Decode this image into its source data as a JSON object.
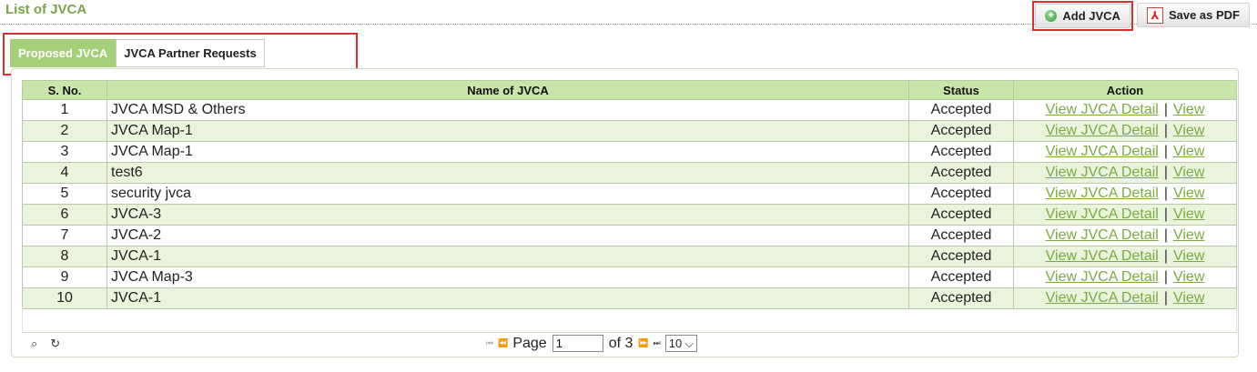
{
  "page": {
    "title": "List of JVCA"
  },
  "toolbar": {
    "add_label": "Add JVCA",
    "add_icon": "plus-circle-icon",
    "pdf_label": "Save as PDF",
    "pdf_icon": "pdf-icon"
  },
  "tabs": [
    {
      "label": "Proposed JVCA",
      "active": true
    },
    {
      "label": "JVCA Partner Requests",
      "active": false
    }
  ],
  "table": {
    "headers": [
      "S. No.",
      "Name of JVCA",
      "Status",
      "Action"
    ],
    "action_detail": "View JVCA Detail",
    "action_sep": "|",
    "action_view": "View",
    "rows": [
      {
        "sno": "1",
        "name": "JVCA MSD & Others",
        "status": "Accepted"
      },
      {
        "sno": "2",
        "name": "JVCA Map-1",
        "status": "Accepted"
      },
      {
        "sno": "3",
        "name": "JVCA Map-1",
        "status": "Accepted"
      },
      {
        "sno": "4",
        "name": "test6",
        "status": "Accepted"
      },
      {
        "sno": "5",
        "name": "security jvca",
        "status": "Accepted"
      },
      {
        "sno": "6",
        "name": "JVCA-3",
        "status": "Accepted"
      },
      {
        "sno": "7",
        "name": "JVCA-2",
        "status": "Accepted"
      },
      {
        "sno": "8",
        "name": "JVCA-1",
        "status": "Accepted"
      },
      {
        "sno": "9",
        "name": "JVCA Map-3",
        "status": "Accepted"
      },
      {
        "sno": "10",
        "name": "JVCA-1",
        "status": "Accepted"
      }
    ]
  },
  "pager": {
    "page_label": "Page",
    "page_value": "1",
    "of_label": "of 3",
    "page_size": "10",
    "first_icon": "⏮",
    "prev_icon": "⏪",
    "next_icon": "⏩",
    "last_icon": "⏭",
    "search_icon": "search-icon",
    "refresh_icon": "refresh-icon"
  },
  "colors": {
    "accent": "#7ba34a",
    "header_bg": "#c8e6aa",
    "row_alt": "#eaf4dd",
    "highlight": "#d93030",
    "link": "#7aab40"
  }
}
